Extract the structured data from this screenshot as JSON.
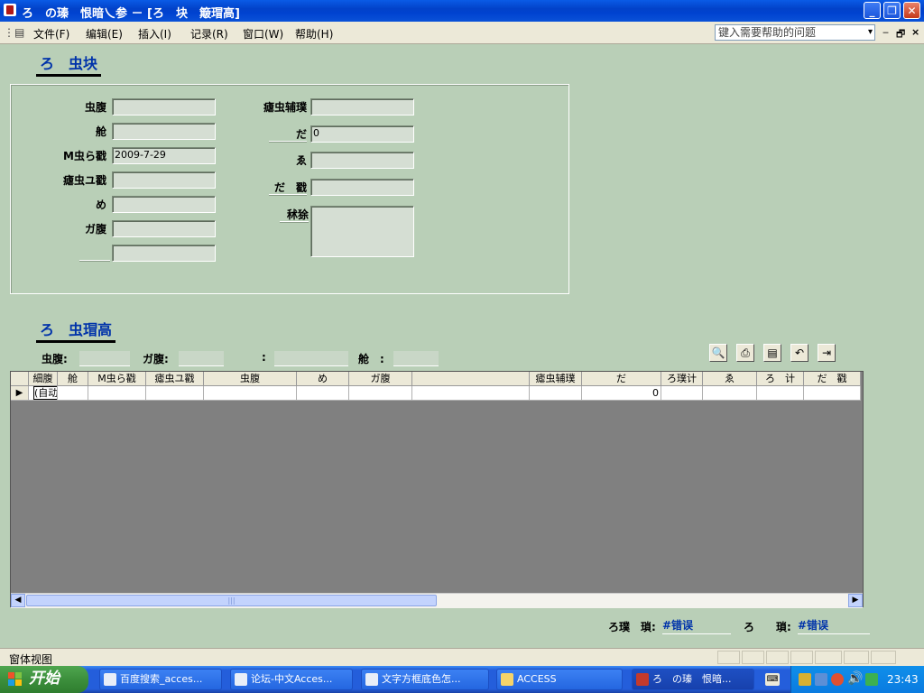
{
  "window": {
    "title": "ろ　の瑧　恨�athlete氵参 － [ろ　块　簸瑁高]",
    "title_display": "ろ　の瑧　恨暗乀参 － [ろ　块　簸瑁高]"
  },
  "menu": {
    "items": [
      "文件(F)",
      "编辑(E)",
      "插入(I)",
      "记录(R)",
      "窗口(W)",
      "帮助(H)"
    ],
    "help_placeholder": "键入需要帮助的问题"
  },
  "section1": {
    "title": "ろ　虫块",
    "labels_left": [
      "虫腹",
      "舱",
      "M虫ら戳",
      "瘧虫ユ戳",
      "め",
      "ガ腹",
      ""
    ],
    "values_left": [
      "",
      "",
      "2009-7-29",
      "",
      "",
      "",
      ""
    ],
    "labels_right": [
      "瘧虫辅璞",
      "だ",
      "ゑ",
      "だ　戳",
      "秫狳"
    ],
    "values_right": [
      "",
      "0",
      "",
      "",
      ""
    ]
  },
  "section2": {
    "title": "ろ　虫瑁高",
    "filter_labels": [
      "虫腹:",
      "ガ腹:",
      ":",
      "舱　:"
    ]
  },
  "toolbar": {
    "buttons": [
      "preview-icon",
      "print-icon",
      "copy-icon",
      "undo-icon",
      "exit-icon"
    ]
  },
  "grid": {
    "columns": [
      "細腹",
      "舱",
      "M虫ら戳",
      "瘧虫ユ戳",
      "虫腹",
      "め",
      "ガ腹",
      "",
      "瘧虫辅璞",
      "だ",
      "ろ璞计",
      "ゑ",
      "ろ　计",
      "だ　戳"
    ],
    "row": [
      "(自动",
      "",
      "",
      "",
      "",
      "",
      "",
      "",
      "",
      "0",
      "",
      "",
      "",
      ""
    ]
  },
  "footer": {
    "label1": "ろ璞　瑣:",
    "value1": "#错误",
    "label2": "ろ　　瑣:",
    "value2": "#错误"
  },
  "status": {
    "text": "窗体视图"
  },
  "taskbar": {
    "start": "开始",
    "tasks": [
      "百度搜索_acces...",
      "论坛-中文Acces...",
      "文字方框底色怎...",
      "ACCESS",
      "ろ　の瑧　恨暗..."
    ],
    "clock": "23:43"
  },
  "colors": {
    "form_bg": "#b9cfb7",
    "title_blue": "#0033aa",
    "field_bg": "#d5ded3",
    "error_blue": "#0033aa"
  }
}
